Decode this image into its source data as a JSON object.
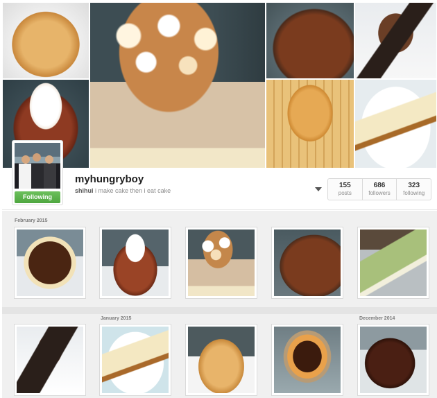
{
  "profile": {
    "username": "myhungryboy",
    "name": "shihui",
    "bio": "i make cake then i eat cake",
    "follow_label": "Following"
  },
  "stats": [
    {
      "value": "155",
      "label": "posts"
    },
    {
      "value": "686",
      "label": "followers"
    },
    {
      "value": "323",
      "label": "following"
    }
  ],
  "feed": {
    "months": [
      "February 2015",
      "January 2015",
      "December 2014"
    ]
  },
  "colors": {
    "follow_button": "#4ea63f",
    "feed_background": "#f0f0f0"
  }
}
